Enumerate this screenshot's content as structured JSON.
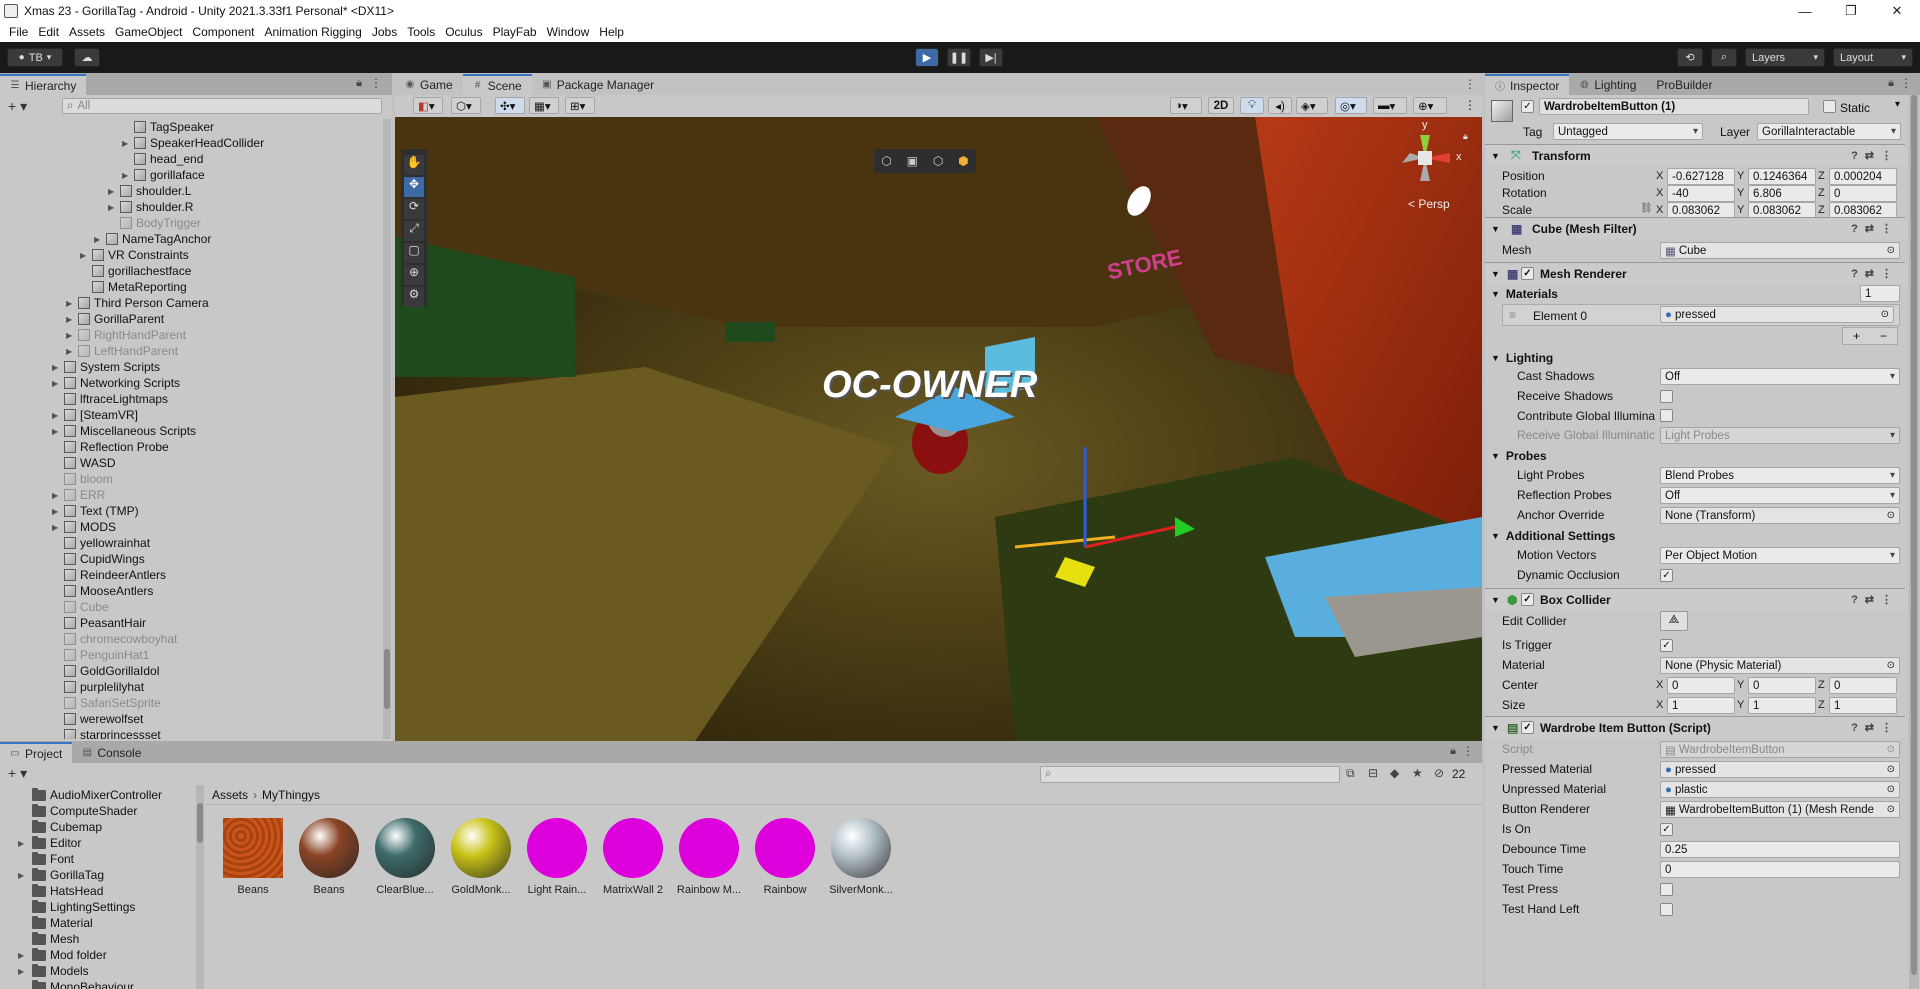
{
  "window": {
    "title": "Xmas 23 - GorillaTag - Android - Unity 2021.3.33f1 Personal* <DX11>"
  },
  "menu": [
    "File",
    "Edit",
    "Assets",
    "GameObject",
    "Component",
    "Animation Rigging",
    "Jobs",
    "Tools",
    "Oculus",
    "PlayFab",
    "Window",
    "Help"
  ],
  "toolbar": {
    "account": "TB",
    "layers": "Layers",
    "layout": "Layout"
  },
  "hierarchy": {
    "tab": "Hierarchy",
    "search_placeholder": "All",
    "items": [
      {
        "label": "TagSpeaker",
        "depth": 6,
        "arrow": false,
        "dim": false
      },
      {
        "label": "SpeakerHeadCollider",
        "depth": 6,
        "arrow": true,
        "dim": false
      },
      {
        "label": "head_end",
        "depth": 6,
        "arrow": false,
        "dim": false
      },
      {
        "label": "gorillaface",
        "depth": 6,
        "arrow": true,
        "dim": false
      },
      {
        "label": "shoulder.L",
        "depth": 5,
        "arrow": true,
        "dim": false
      },
      {
        "label": "shoulder.R",
        "depth": 5,
        "arrow": true,
        "dim": false
      },
      {
        "label": "BodyTrigger",
        "depth": 5,
        "arrow": false,
        "dim": true
      },
      {
        "label": "NameTagAnchor",
        "depth": 4,
        "arrow": true,
        "dim": false
      },
      {
        "label": "VR Constraints",
        "depth": 3,
        "arrow": true,
        "dim": false
      },
      {
        "label": "gorillachestface",
        "depth": 3,
        "arrow": false,
        "dim": false
      },
      {
        "label": "MetaReporting",
        "depth": 3,
        "arrow": false,
        "dim": false
      },
      {
        "label": "Third Person Camera",
        "depth": 2,
        "arrow": true,
        "dim": false
      },
      {
        "label": "GorillaParent",
        "depth": 2,
        "arrow": true,
        "dim": false
      },
      {
        "label": "RightHandParent",
        "depth": 2,
        "arrow": true,
        "dim": true
      },
      {
        "label": "LeftHandParent",
        "depth": 2,
        "arrow": true,
        "dim": true
      },
      {
        "label": "System Scripts",
        "depth": 1,
        "arrow": true,
        "dim": false
      },
      {
        "label": "Networking Scripts",
        "depth": 1,
        "arrow": true,
        "dim": false
      },
      {
        "label": "lftraceLightmaps",
        "depth": 1,
        "arrow": false,
        "dim": false
      },
      {
        "label": "[SteamVR]",
        "depth": 1,
        "arrow": true,
        "dim": false
      },
      {
        "label": "Miscellaneous Scripts",
        "depth": 1,
        "arrow": true,
        "dim": false
      },
      {
        "label": "Reflection Probe",
        "depth": 1,
        "arrow": false,
        "dim": false
      },
      {
        "label": "WASD",
        "depth": 1,
        "arrow": false,
        "dim": false
      },
      {
        "label": "bloom",
        "depth": 1,
        "arrow": false,
        "dim": true
      },
      {
        "label": "ERR",
        "depth": 1,
        "arrow": true,
        "dim": true
      },
      {
        "label": "Text (TMP)",
        "depth": 1,
        "arrow": true,
        "dim": false
      },
      {
        "label": "MODS",
        "depth": 1,
        "arrow": true,
        "dim": false
      },
      {
        "label": "yellowrainhat",
        "depth": 1,
        "arrow": false,
        "dim": false
      },
      {
        "label": "CupidWings",
        "depth": 1,
        "arrow": false,
        "dim": false
      },
      {
        "label": "ReindeerAntlers",
        "depth": 1,
        "arrow": false,
        "dim": false
      },
      {
        "label": "MooseAntlers",
        "depth": 1,
        "arrow": false,
        "dim": false
      },
      {
        "label": "Cube",
        "depth": 1,
        "arrow": false,
        "dim": true
      },
      {
        "label": "PeasantHair",
        "depth": 1,
        "arrow": false,
        "dim": false
      },
      {
        "label": "chromecowboyhat",
        "depth": 1,
        "arrow": false,
        "dim": true
      },
      {
        "label": "PenguinHat1",
        "depth": 1,
        "arrow": false,
        "dim": true
      },
      {
        "label": "GoldGorillaIdol",
        "depth": 1,
        "arrow": false,
        "dim": false
      },
      {
        "label": "purplelilyhat",
        "depth": 1,
        "arrow": false,
        "dim": false
      },
      {
        "label": "SafariSetSprite",
        "depth": 1,
        "arrow": false,
        "dim": true
      },
      {
        "label": "werewolfset",
        "depth": 1,
        "arrow": false,
        "dim": false
      },
      {
        "label": "starprincessset",
        "depth": 1,
        "arrow": false,
        "dim": false
      }
    ]
  },
  "scene": {
    "tabs": [
      "Game",
      "Scene",
      "Package Manager"
    ],
    "two_d": "2D",
    "persp": "< Persp",
    "gizmo_axes": {
      "y": "y",
      "x": "x"
    },
    "sign_text": "OC-OWNER",
    "store_text": "STORE"
  },
  "inspector": {
    "tabs": [
      "Inspector",
      "Lighting",
      "ProBuilder"
    ],
    "object_name": "WardrobeItemButton (1)",
    "static_label": "Static",
    "tag_label": "Tag",
    "tag_value": "Untagged",
    "layer_label": "Layer",
    "layer_value": "GorillaInteractable",
    "transform": {
      "title": "Transform",
      "position_label": "Position",
      "position": [
        "-0.627128",
        "0.1246364",
        "0.000204"
      ],
      "rotation_label": "Rotation",
      "rotation": [
        "-40",
        "6.806",
        "0"
      ],
      "scale_label": "Scale",
      "scale": [
        "0.083062",
        "0.083062",
        "0.083062"
      ]
    },
    "mesh_filter": {
      "title": "Cube (Mesh Filter)",
      "mesh_label": "Mesh",
      "mesh_value": "Cube"
    },
    "mesh_renderer": {
      "title": "Mesh Renderer",
      "materials_label": "Materials",
      "materials_count": "1",
      "element0_label": "Element 0",
      "element0_value": "pressed",
      "lighting_label": "Lighting",
      "cast_shadows_label": "Cast Shadows",
      "cast_shadows": "Off",
      "receive_shadows_label": "Receive Shadows",
      "contribute_gi_label": "Contribute Global Illumina",
      "receive_gi_label": "Receive Global Illuminatic",
      "receive_gi": "Light Probes",
      "probes_label": "Probes",
      "light_probes_label": "Light Probes",
      "light_probes": "Blend Probes",
      "reflection_probes_label": "Reflection Probes",
      "reflection_probes": "Off",
      "anchor_override_label": "Anchor Override",
      "anchor_override": "None (Transform)",
      "additional_label": "Additional Settings",
      "motion_vectors_label": "Motion Vectors",
      "motion_vectors": "Per Object Motion",
      "dynamic_occlusion_label": "Dynamic Occlusion"
    },
    "box_collider": {
      "title": "Box Collider",
      "edit_label": "Edit Collider",
      "trigger_label": "Is Trigger",
      "material_label": "Material",
      "material_value": "None (Physic Material)",
      "center_label": "Center",
      "center": [
        "0",
        "0",
        "0"
      ],
      "size_label": "Size",
      "size": [
        "1",
        "1",
        "1"
      ]
    },
    "script": {
      "title": "Wardrobe Item Button (Script)",
      "script_label": "Script",
      "script_value": "WardrobeItemButton",
      "pressed_label": "Pressed Material",
      "pressed_value": "pressed",
      "unpressed_label": "Unpressed Material",
      "unpressed_value": "plastic",
      "renderer_label": "Button Renderer",
      "renderer_value": "WardrobeItemButton (1) (Mesh Rende",
      "ison_label": "Is On",
      "debounce_label": "Debounce Time",
      "debounce_value": "0.25",
      "touch_label": "Touch Time",
      "touch_value": "0",
      "testpress_label": "Test Press",
      "testhand_label": "Test Hand Left"
    }
  },
  "project": {
    "tabs": [
      "Project",
      "Console"
    ],
    "hidden_count": "22",
    "breadcrumb": [
      "Assets",
      "MyThingys"
    ],
    "folders": [
      {
        "label": "AudioMixerController",
        "arrow": false
      },
      {
        "label": "ComputeShader",
        "arrow": false
      },
      {
        "label": "Cubemap",
        "arrow": false
      },
      {
        "label": "Editor",
        "arrow": true
      },
      {
        "label": "Font",
        "arrow": false
      },
      {
        "label": "GorillaTag",
        "arrow": true
      },
      {
        "label": "HatsHead",
        "arrow": false
      },
      {
        "label": "LightingSettings",
        "arrow": false
      },
      {
        "label": "Material",
        "arrow": false
      },
      {
        "label": "Mesh",
        "arrow": false
      },
      {
        "label": "Mod folder",
        "arrow": true
      },
      {
        "label": "Models",
        "arrow": true
      },
      {
        "label": "MonoBehaviour",
        "arrow": false
      }
    ],
    "assets": [
      {
        "label": "Beans",
        "kind": "square",
        "color": "#c9551c"
      },
      {
        "label": "Beans",
        "kind": "ball",
        "color": "#8a4425"
      },
      {
        "label": "ClearBlue...",
        "kind": "ball",
        "color": "#3e6b6b"
      },
      {
        "label": "GoldMonk...",
        "kind": "ball",
        "color": "#c9c418"
      },
      {
        "label": "Light Rain...",
        "kind": "ball",
        "color": "#dd00dd"
      },
      {
        "label": "MatrixWall 2",
        "kind": "ball",
        "color": "#dd00dd"
      },
      {
        "label": "Rainbow M...",
        "kind": "ball",
        "color": "#dd00dd"
      },
      {
        "label": "Rainbow",
        "kind": "ball",
        "color": "#dd00dd"
      },
      {
        "label": "SilverMonk...",
        "kind": "ball",
        "color": "#b8c4cc"
      }
    ]
  }
}
